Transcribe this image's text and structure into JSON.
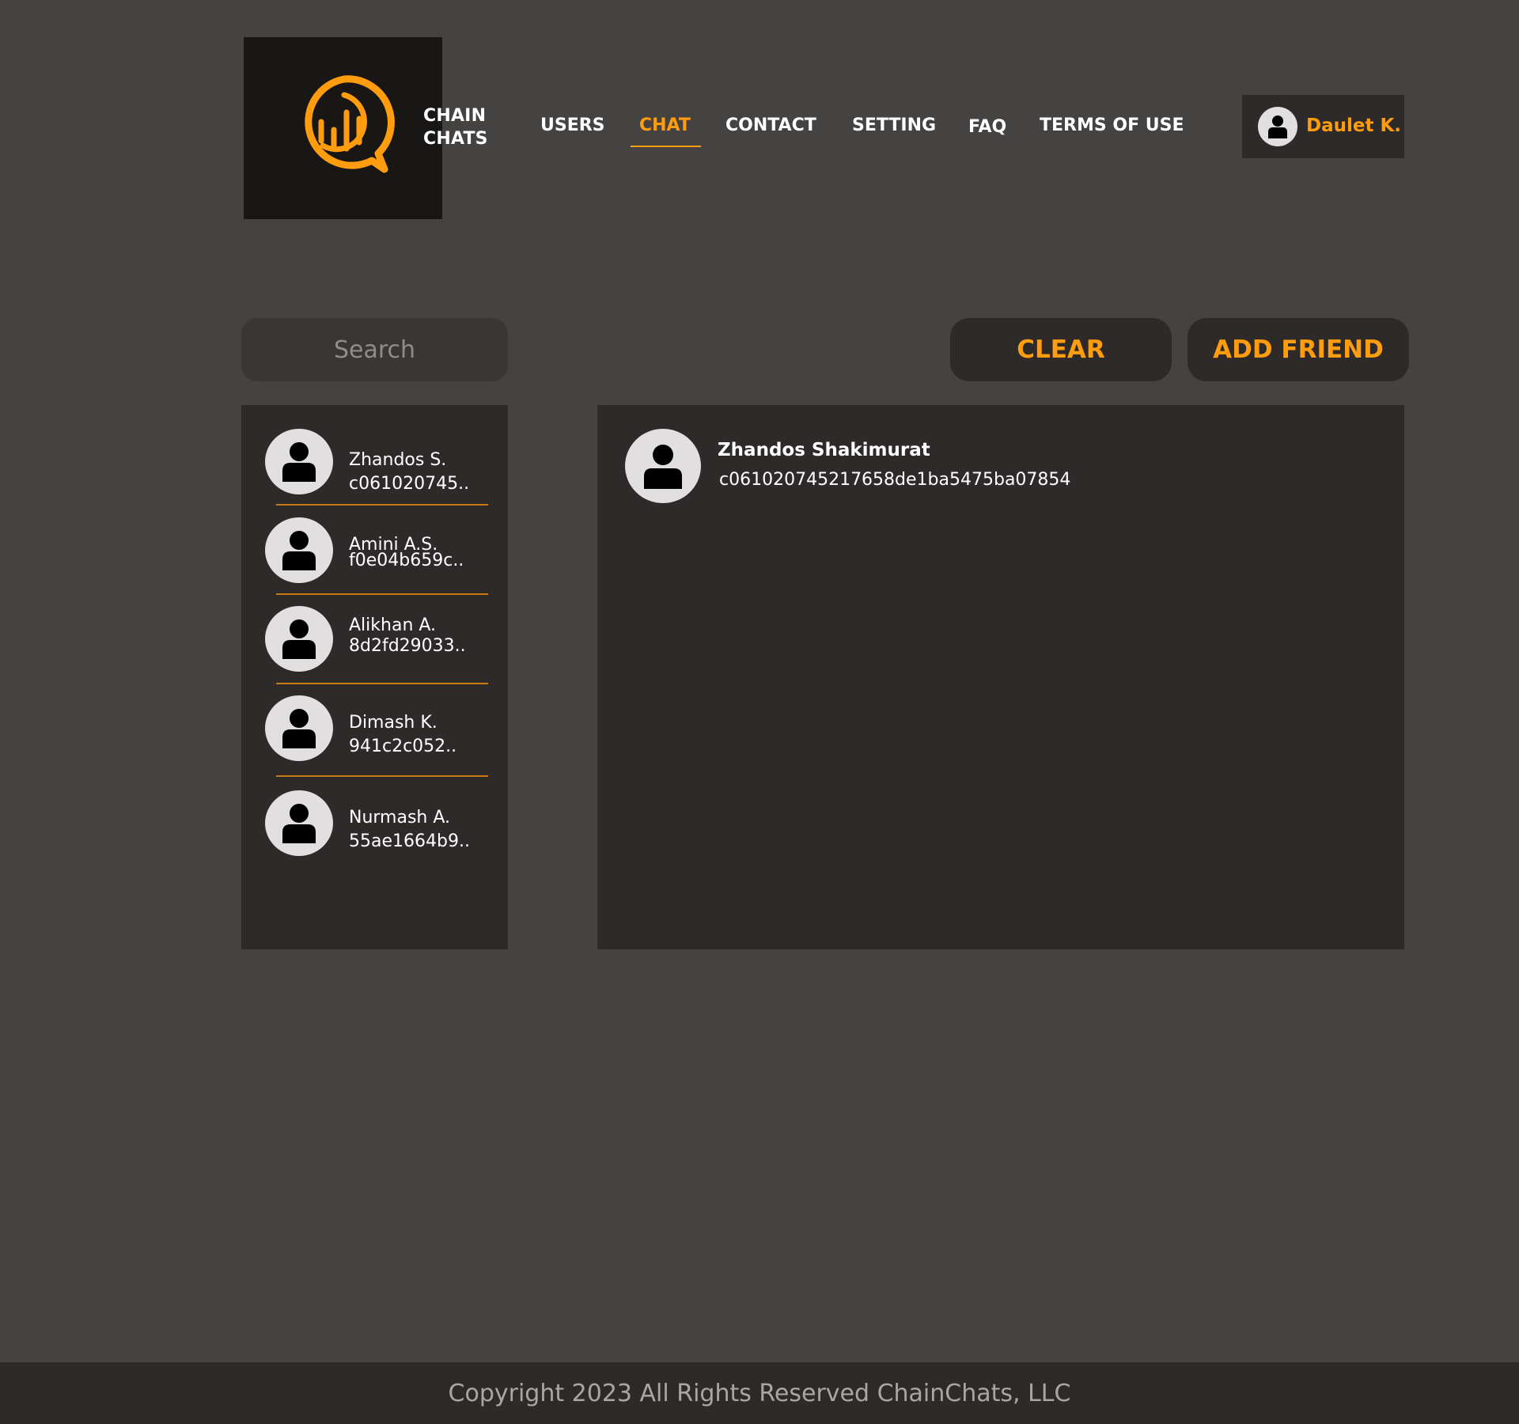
{
  "brand": {
    "logo_icon": "chat-bubble-chart-icon",
    "line1": "CHAIN",
    "line2": "CHATS",
    "accent_color": "#ff9d0e"
  },
  "nav": {
    "items": [
      {
        "label": "USERS",
        "active": false
      },
      {
        "label": "CHAT",
        "active": true
      },
      {
        "label": "CONTACT",
        "active": false
      },
      {
        "label": "SETTING",
        "active": false
      },
      {
        "label": "FAQ",
        "active": false
      },
      {
        "label": "TERMS OF USE",
        "active": false
      }
    ]
  },
  "user": {
    "name": "Daulet K.",
    "avatar_icon": "user-icon"
  },
  "search": {
    "placeholder": "Search",
    "value": ""
  },
  "actions": {
    "clear_label": "CLEAR",
    "add_friend_label": "ADD FRIEND"
  },
  "contacts": [
    {
      "name": "Zhandos  S.",
      "id": "c061020745.."
    },
    {
      "name": "Amini A.S.",
      "id": "f0e04b659c.."
    },
    {
      "name": "Alikhan A.",
      "id": "8d2fd29033.."
    },
    {
      "name": "Dimash K.",
      "id": "941c2c052.."
    },
    {
      "name": "Nurmash  A.",
      "id": "55ae1664b9.."
    }
  ],
  "chat": {
    "name": "Zhandos Shakimurat",
    "id": "c061020745217658de1ba5475ba07854"
  },
  "footer": {
    "text": "Copyright 2023 All Rights Reserved ChainChats, LLC"
  }
}
